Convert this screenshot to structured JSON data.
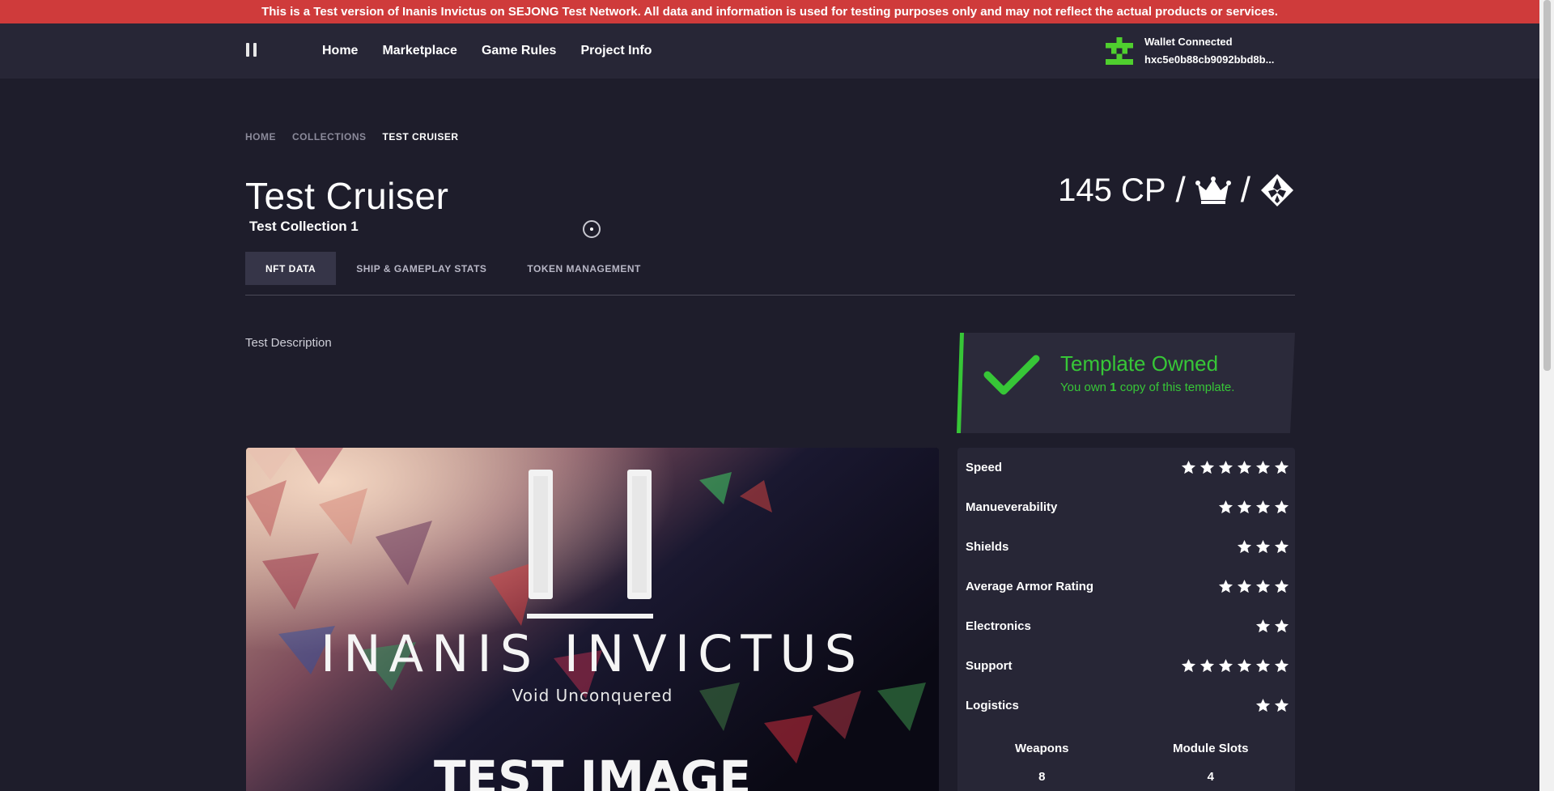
{
  "banner": {
    "text": "This is a Test version of Inanis Invictus on SEJONG Test Network. All data and information is used for testing purposes only and may not reflect the actual products or services."
  },
  "nav": {
    "links": [
      "Home",
      "Marketplace",
      "Game Rules",
      "Project Info"
    ],
    "wallet": {
      "status": "Wallet Connected",
      "address": "hxc5e0b88cb9092bbd8b..."
    }
  },
  "breadcrumb": [
    "HOME",
    "COLLECTIONS",
    "TEST CRUISER"
  ],
  "item": {
    "title": "Test Cruiser",
    "collection": "Test Collection 1",
    "price": "145 CP",
    "price_icons": [
      "crown-icon",
      "icx-diamond-icon"
    ],
    "description": "Test Description"
  },
  "tabs": [
    "NFT DATA",
    "SHIP & GAMEPLAY STATS",
    "TOKEN MANAGEMENT"
  ],
  "owned": {
    "title": "Template Owned",
    "text_before": "You own",
    "count": "1",
    "text_after": "copy of this template."
  },
  "hero": {
    "logo_text": "INANIS INVICTUS",
    "tagline": "Void Unconquered",
    "overlay": "TEST IMAGE"
  },
  "stats": [
    {
      "label": "Speed",
      "stars": 6
    },
    {
      "label": "Manueverability",
      "stars": 4
    },
    {
      "label": "Shields",
      "stars": 3
    },
    {
      "label": "Average Armor Rating",
      "stars": 4
    },
    {
      "label": "Electronics",
      "stars": 2
    },
    {
      "label": "Support",
      "stars": 6
    },
    {
      "label": "Logistics",
      "stars": 2
    }
  ],
  "counts": [
    {
      "label": "Weapons",
      "value": "8"
    },
    {
      "label": "Module Slots",
      "value": "4"
    }
  ],
  "colors": {
    "banner": "#cf3b3b",
    "accent_green": "#37c637",
    "background": "#1e1d2b",
    "panel": "#272636"
  }
}
